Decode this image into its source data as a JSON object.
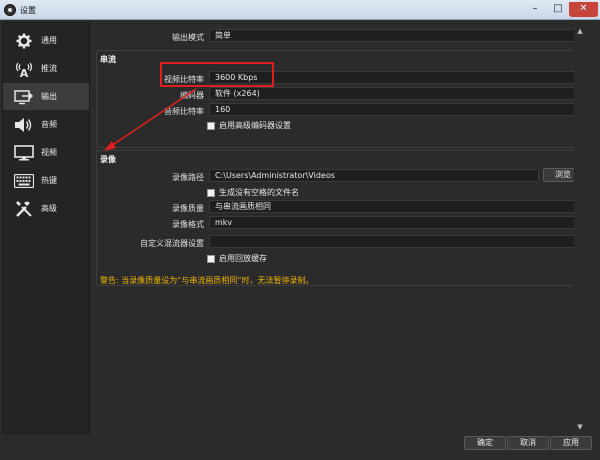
{
  "window": {
    "title": "设置"
  },
  "sidebar": {
    "items": [
      {
        "label": "通用",
        "icon": "gear-icon"
      },
      {
        "label": "推流",
        "icon": "antenna-icon"
      },
      {
        "label": "输出",
        "icon": "output-icon"
      },
      {
        "label": "音频",
        "icon": "speaker-icon"
      },
      {
        "label": "视频",
        "icon": "monitor-icon"
      },
      {
        "label": "热键",
        "icon": "keyboard-icon"
      },
      {
        "label": "高级",
        "icon": "tools-icon"
      }
    ],
    "active_index": 2
  },
  "output": {
    "mode_label": "输出模式",
    "mode_value": "简单"
  },
  "streaming": {
    "title": "串流",
    "video_bitrate_label": "视频比特率",
    "video_bitrate_value": "3600 Kbps",
    "encoder_label": "编码器",
    "encoder_value": "软件 (x264)",
    "audio_bitrate_label": "音频比特率",
    "audio_bitrate_value": "160",
    "advanced_encoder_checkbox": "启用高级编码器设置"
  },
  "recording": {
    "title": "录像",
    "path_label": "录像路径",
    "path_value": "C:\\Users\\Administrator\\Videos",
    "browse_label": "浏览",
    "no_space_checkbox": "生成没有空格的文件名",
    "quality_label": "录像质量",
    "quality_value": "与串流画质相同",
    "format_label": "录像格式",
    "format_value": "mkv",
    "muxer_label": "自定义混流器设置",
    "muxer_value": "",
    "replay_buffer_checkbox": "启用回放缓存"
  },
  "warning": "警告: 当录像质量设为“与串流画质相同”时，无法暂停录制。",
  "footer": {
    "ok_label": "确定",
    "cancel_label": "取消",
    "apply_label": "应用"
  },
  "colors": {
    "highlight": "#e0201e",
    "warning": "#f0b400",
    "background": "#2b2b2b",
    "active_nav": "#3c3c3c"
  }
}
